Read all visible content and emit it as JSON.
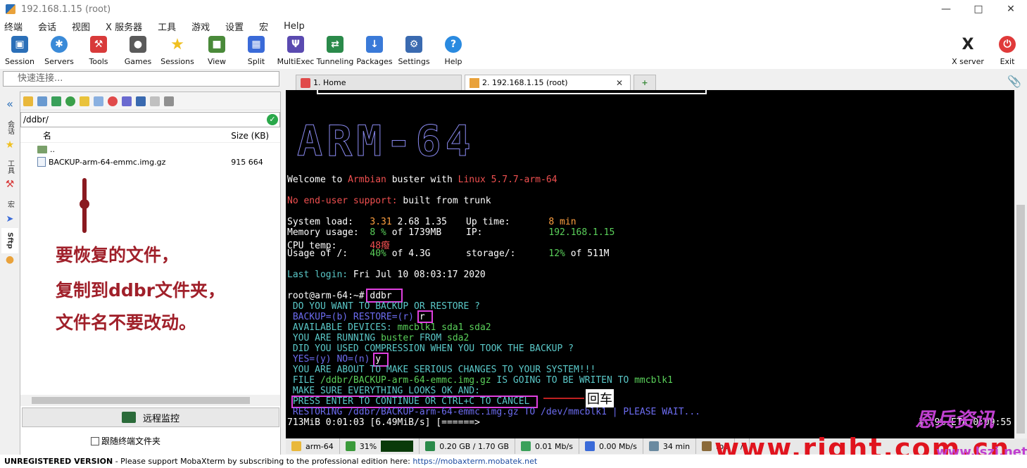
{
  "window": {
    "title": "192.168.1.15 (root)"
  },
  "menu": [
    "终端",
    "会话",
    "视图",
    "X 服务器",
    "工具",
    "游戏",
    "设置",
    "宏",
    "Help"
  ],
  "toolbar": {
    "items": [
      {
        "label": "Session",
        "icon": "session-icon",
        "color": "#2b6fb8"
      },
      {
        "label": "Servers",
        "icon": "servers-icon",
        "color": "#3a8ad8"
      },
      {
        "label": "Tools",
        "icon": "tools-icon",
        "color": "#d83a3a"
      },
      {
        "label": "Games",
        "icon": "games-icon",
        "color": "#5a5a5a"
      },
      {
        "label": "Sessions",
        "icon": "star-icon",
        "color": "#f0c020"
      },
      {
        "label": "View",
        "icon": "view-icon",
        "color": "#4a8a3a"
      },
      {
        "label": "Split",
        "icon": "split-icon",
        "color": "#3a6ad8"
      },
      {
        "label": "MultiExec",
        "icon": "multiexec-icon",
        "color": "#5a4ab0"
      },
      {
        "label": "Tunneling",
        "icon": "tunneling-icon",
        "color": "#2a8a4a"
      },
      {
        "label": "Packages",
        "icon": "packages-icon",
        "color": "#3a7ad8"
      },
      {
        "label": "Settings",
        "icon": "settings-icon",
        "color": "#3a6ab0"
      },
      {
        "label": "Help",
        "icon": "help-icon",
        "color": "#2a8ae0"
      }
    ],
    "right": [
      {
        "label": "X server",
        "icon": "x-server-icon",
        "color": "#2a2a2a"
      },
      {
        "label": "Exit",
        "icon": "exit-icon",
        "color": "#e03a3a"
      }
    ]
  },
  "quick_connect": {
    "placeholder": "快速连接..."
  },
  "sidebar_tabs": [
    "会话",
    "工具",
    "宏",
    "Sftp"
  ],
  "sftp": {
    "path": "/ddbr/",
    "columns": {
      "name": "名",
      "size": "Size (KB)"
    },
    "rows": [
      {
        "name": "..",
        "size": ""
      },
      {
        "name": "BACKUP-arm-64-emmc.img.gz",
        "size": "915 664"
      }
    ],
    "remote_monitor": "远程监控",
    "follow_terminal": "跟随终端文件夹"
  },
  "annotation": {
    "line1": "要恢复的文件，",
    "line2": "复制到ddbr文件夹，",
    "line3": "文件名不要改动。",
    "enter": "回车"
  },
  "tabs": [
    {
      "label": "1. Home"
    },
    {
      "label": "2. 192.168.1.15 (root)"
    }
  ],
  "terminal": {
    "logo": "ARM-64",
    "welcome_a": "Welcome to ",
    "welcome_b": "Armbian",
    "welcome_c": " buster with ",
    "welcome_d": "Linux 5.7.7-arm-64",
    "support_a": "No end-user support:",
    "support_b": " built from trunk",
    "sys_load_label": "System load:   ",
    "sys_load_a": "3.31",
    "sys_load_b": " 2.68 1.35",
    "uptime_label": "Up time:       ",
    "uptime": "8 min",
    "mem_label": "Memory usage:  ",
    "mem_a": "8 %",
    "mem_b": " of 1739MB",
    "ip_label": "IP:            ",
    "ip": "192.168.1.15",
    "cpu_label": "CPU temp:      ",
    "cpu": "48癈",
    "usage_label": "Usage of /:    ",
    "usage_a": "40%",
    "usage_b": " of 4.3G",
    "storage_label": "storage/:      ",
    "storage_a": "12%",
    "storage_b": " of 511M",
    "last_login_a": "Last login:",
    "last_login_b": " Fri Jul 10 08:03:17 2020",
    "prompt": "root@arm-64:~# ",
    "cmd": "ddbr",
    "q1": " DO YOU WANT TO BACKUP OR RESTORE ?",
    "q2": " BACKUP=(b) RESTORE=(r) ",
    "a2": "r",
    "devices_a": " AVAILABLE DEVICES: ",
    "devices_b": "mmcblk1 sda1 sda2",
    "running_a": " YOU ARE RUNNING ",
    "running_b": "buster",
    "running_c": " FROM ",
    "running_d": "sda2",
    "compress": " DID YOU USED COMPRESSION WHEN YOU TOOK THE BACKUP ?",
    "yesno": " YES=(y) NO=(n) ",
    "a3": "y",
    "serious": " YOU ARE ABOUT TO MAKE SERIOUS CHANGES TO YOUR SYSTEM!!!",
    "file_a": " FILE ",
    "file_b": "/ddbr/BACKUP-arm-64-emmc.img.gz",
    "file_c": " IS GOING TO BE WRITEN TO ",
    "file_d": "mmcblk1",
    "make_sure": " MAKE SURE EVERYTHING LOOKS OK AND:",
    "press": " PRESS ENTER TO CONTINUE OR CTRL+C TO CANCEL",
    "restoring": " RESTORING /ddbr/BACKUP-arm-64-emmc.img.gz TO /dev/mmcblk1 | PLEASE WAIT...",
    "progress": "713MiB 0:01:03 [6.49MiB/s] [======>",
    "progress_right": "]  9% ETA 0:09:55"
  },
  "status": {
    "host": "arm-64",
    "cpu": "31%",
    "mem": "0.20 GB / 1.70 GB",
    "up": "0.01 Mb/s",
    "down": "0.00 Mb/s",
    "time": "34 min",
    "user": "roo",
    "path": "/"
  },
  "watermark": {
    "url": "www.right.com.cn",
    "brand": "恩兵资讯",
    "site": "www.lszi.net"
  },
  "footer": {
    "unregistered": "UNREGISTERED VERSION",
    "text": " -  Please support MobaXterm by subscribing to the professional edition here: ",
    "link": "https://mobaxterm.mobatek.net"
  }
}
